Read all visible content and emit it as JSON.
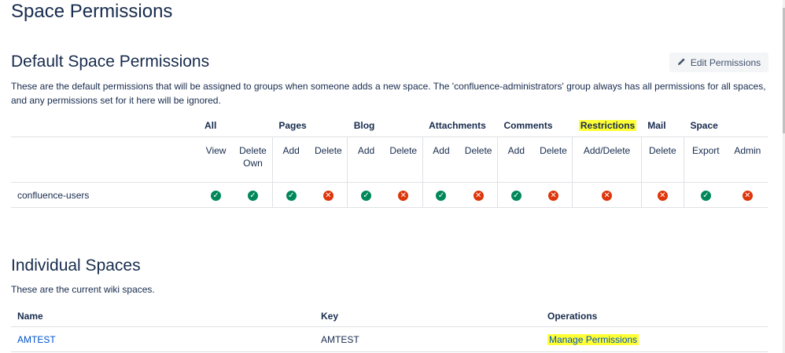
{
  "page": {
    "title": "Space Permissions"
  },
  "default_section": {
    "title": "Default Space Permissions",
    "description": "These are the default permissions that will be assigned to groups when someone adds a new space. The 'confluence-administrators' group always has all permissions for all spaces, and any permissions set for it here will be ignored.",
    "edit_button": "Edit Permissions",
    "groups": [
      "All",
      "Pages",
      "Blog",
      "Attachments",
      "Comments",
      "Restrictions",
      "Mail",
      "Space"
    ],
    "permissions": [
      "View",
      "Delete Own",
      "Add",
      "Delete",
      "Add",
      "Delete",
      "Add",
      "Delete",
      "Add",
      "Delete",
      "Add/Delete",
      "Delete",
      "Export",
      "Admin"
    ],
    "rows": [
      {
        "group": "confluence-users",
        "values": [
          true,
          true,
          true,
          false,
          true,
          false,
          true,
          false,
          true,
          false,
          false,
          false,
          true,
          false
        ]
      }
    ]
  },
  "individual_section": {
    "title": "Individual Spaces",
    "description": "These are the current wiki spaces.",
    "columns": [
      "Name",
      "Key",
      "Operations"
    ],
    "spaces": [
      {
        "name": "AMTEST",
        "key": "AMTEST",
        "operation": "Manage Permissions"
      }
    ]
  },
  "colors": {
    "allowed": "#00875a",
    "denied": "#de350b",
    "highlight": "#ffff33",
    "link": "#0052cc"
  }
}
